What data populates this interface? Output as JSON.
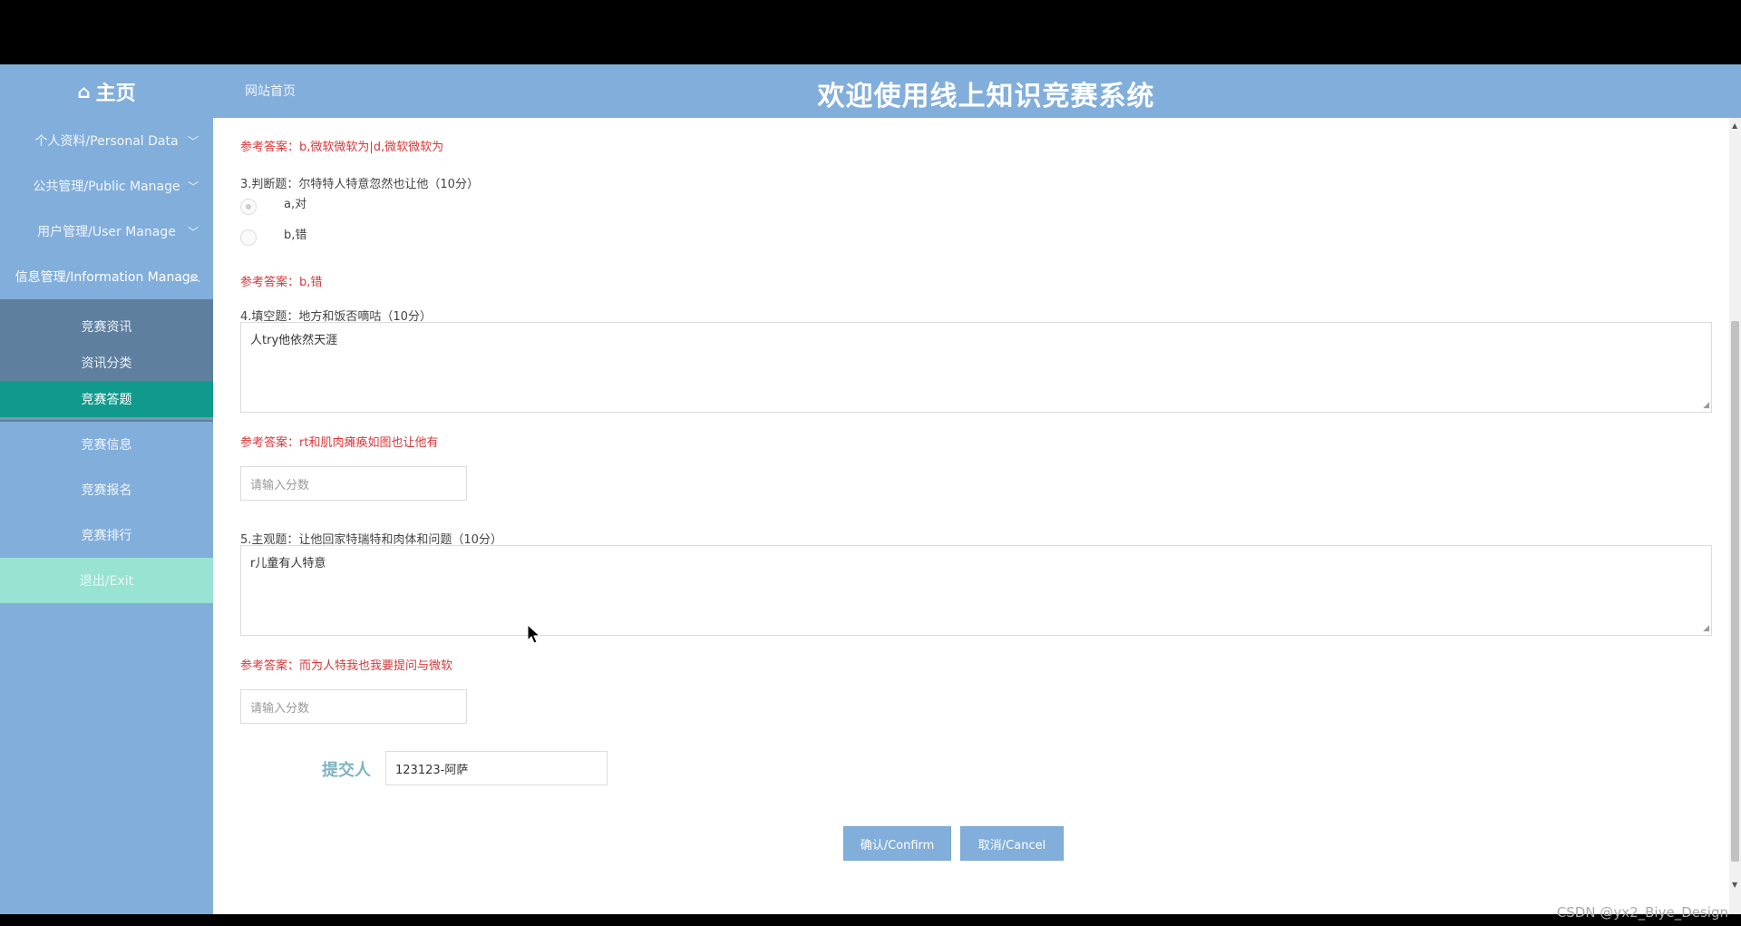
{
  "header": {
    "brand": "主页",
    "site_home": "网站首页",
    "title": "欢迎使用线上知识竞赛系统"
  },
  "sidebar": {
    "items": [
      {
        "label": "个人资料/Personal Data"
      },
      {
        "label": "公共管理/Public Manage"
      },
      {
        "label": "用户管理/User Manage"
      },
      {
        "label": "信息管理/Information Manage"
      }
    ],
    "submenu": [
      {
        "label": "竞赛资讯"
      },
      {
        "label": "资讯分类"
      },
      {
        "label": "竞赛答题"
      }
    ],
    "lower_items": [
      {
        "label": "竞赛信息"
      },
      {
        "label": "竞赛报名"
      },
      {
        "label": "竞赛排行"
      }
    ],
    "exit": "退出/Exit"
  },
  "main": {
    "q2_answer": "参考答案：b,微软微软为|d,微软微软为",
    "q3": {
      "question": "3.判断题：尔特特人特意忽然也让他（10分）",
      "options": [
        "a,对",
        "b,错"
      ],
      "answer": "参考答案：b,错"
    },
    "q4": {
      "question": "4.填空题：地方和饭否嘀咕（10分）",
      "response": "人try他依然天涯",
      "answer": "参考答案：rt和肌肉瘫痪如图也让他有",
      "score_placeholder": "请输入分数"
    },
    "q5": {
      "question": "5.主观题：让他回家特瑞特和肉体和问题（10分）",
      "response": "r儿童有人特意",
      "answer": "参考答案：而为人特我也我要提问与微软",
      "score_placeholder": "请输入分数"
    },
    "submitter": {
      "label": "提交人",
      "value": "123123-阿萨"
    },
    "buttons": {
      "confirm": "确认/Confirm",
      "cancel": "取消/Cancel"
    }
  },
  "watermark": "CSDN @yx2_Biye_Design",
  "icons": {
    "brand": "home-icon",
    "nav_collapsed": "chevron-down-icon",
    "nav_expanded": "chevron-up-icon",
    "pointer": "mouse-cursor-icon"
  },
  "colors": {
    "header": "#82aedb",
    "sidebar": "#82aedb",
    "submenu": "#5f7f9e",
    "active_item": "#109a8c",
    "exit": "#99e3d3",
    "answer_text": "#d9383a",
    "submitter_label": "#7fb3c3"
  }
}
